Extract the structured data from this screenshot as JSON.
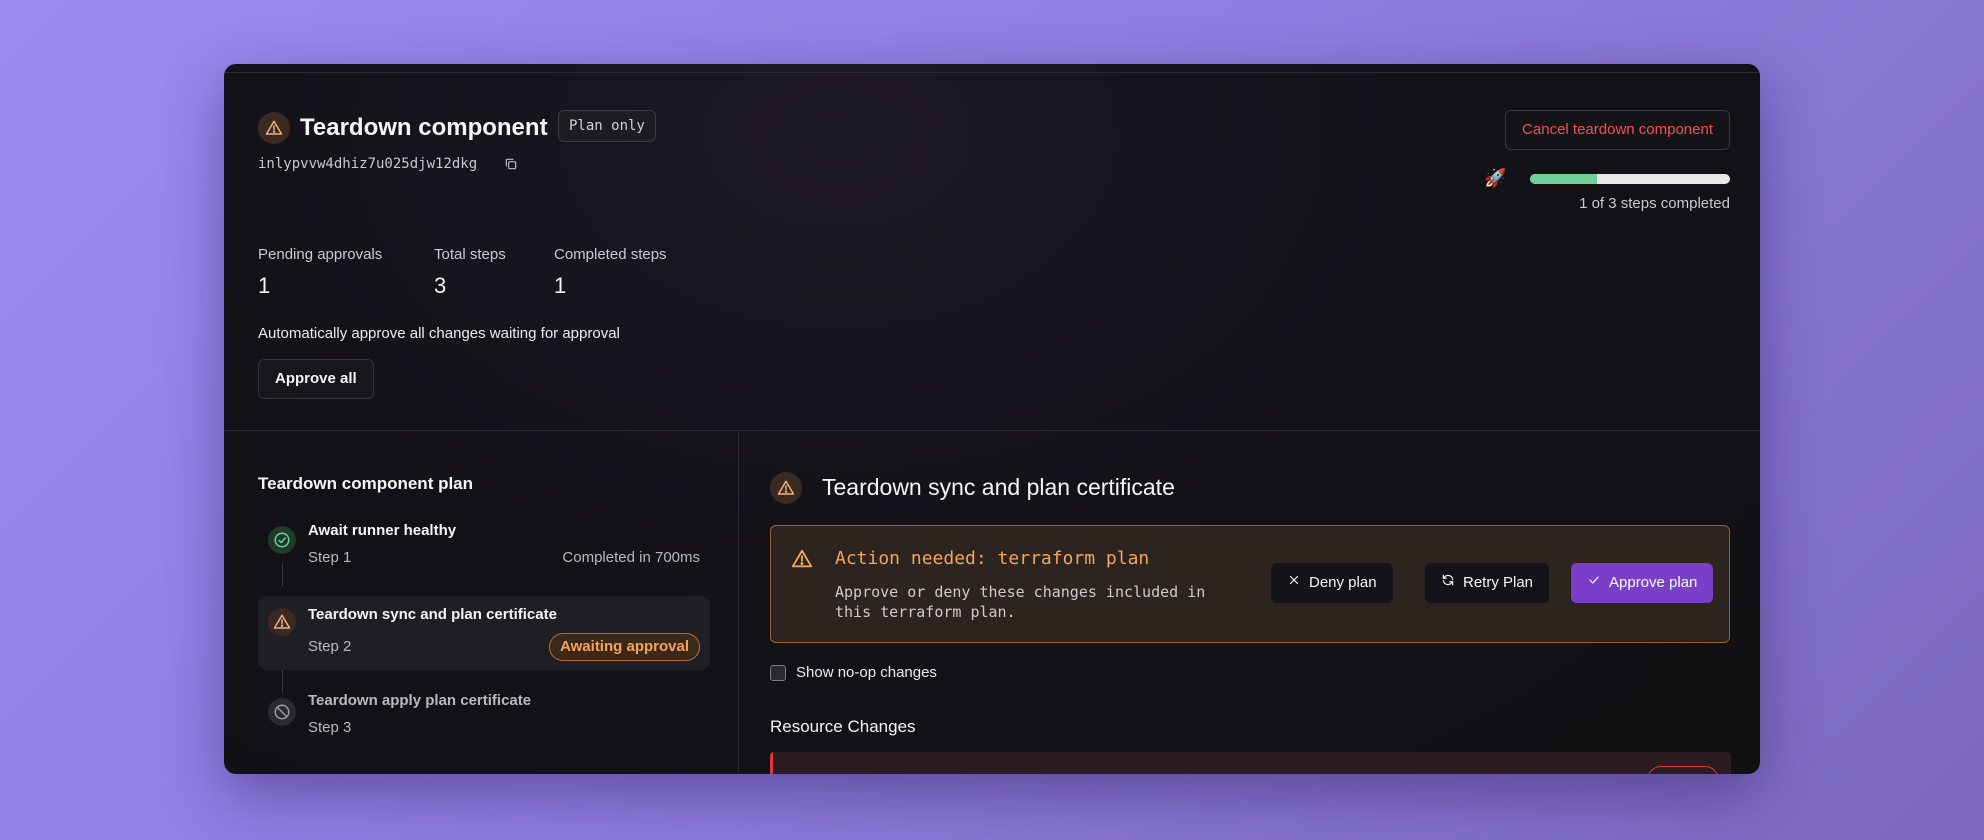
{
  "header": {
    "title": "Teardown component",
    "badge": "Plan only",
    "run_id": "inlypvvw4dhiz7u025djw12dkg",
    "cancel_label": "Cancel teardown component",
    "progress_text": "1 of 3 steps completed",
    "progress_fraction": 0.3333
  },
  "stats": [
    {
      "label": "Pending approvals",
      "value": "1"
    },
    {
      "label": "Total steps",
      "value": "3"
    },
    {
      "label": "Completed steps",
      "value": "1"
    }
  ],
  "auto_approve": {
    "text": "Automatically approve all changes waiting for approval",
    "button": "Approve all"
  },
  "plan": {
    "title": "Teardown component plan",
    "steps": [
      {
        "name": "Await runner healthy",
        "step": "Step 1",
        "status": "Completed in 700ms",
        "state": "completed"
      },
      {
        "name": "Teardown sync and plan certificate",
        "step": "Step 2",
        "status": "Awaiting approval",
        "state": "awaiting"
      },
      {
        "name": "Teardown apply plan certificate",
        "step": "Step 3",
        "status": "",
        "state": "blocked"
      }
    ]
  },
  "detail": {
    "title": "Teardown sync and plan certificate",
    "action_title": "Action needed: terraform plan",
    "action_desc": "Approve or deny these changes included in this terraform plan.",
    "deny_label": "Deny plan",
    "retry_label": "Retry Plan",
    "approve_label": "Approve plan",
    "noop_label": "Show no-op changes",
    "resource_changes_title": "Resource Changes"
  },
  "colors": {
    "accent": "#7a3fc8",
    "warning": "#f3a45b",
    "danger": "#f0524f",
    "success": "#6fcf97"
  }
}
